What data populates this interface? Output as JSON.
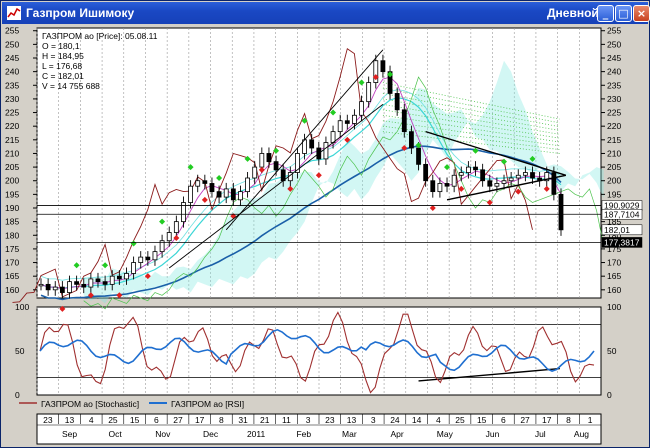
{
  "window": {
    "title": "Газпром Ишимоку",
    "mode": "Дневной"
  },
  "window_buttons": {
    "minimize": "_",
    "maximize": "□",
    "close": "×"
  },
  "price_panel": {
    "info": [
      "ГАЗПРОМ ао [Price]: 05.08.11",
      "O = 180,1",
      "H = 184,95",
      "L = 176,68",
      "C = 182,01",
      "V = 14 755 688"
    ],
    "yticks": [
      160,
      165,
      170,
      175,
      180,
      185,
      190,
      195,
      200,
      205,
      210,
      215,
      220,
      225,
      230,
      235,
      240,
      245,
      250,
      255
    ],
    "ylim": [
      157,
      256
    ],
    "price_labels": [
      {
        "text": "190,9029",
        "value": 190.9,
        "color": "#000000",
        "bg": "#ffffff"
      },
      {
        "text": "187,7104",
        "value": 187.7,
        "color": "#000000",
        "bg": "#ffffff"
      },
      {
        "text": "182,01",
        "value": 182.01,
        "color": "#000000",
        "bg": "#ffffff"
      },
      {
        "text": "177,3817",
        "value": 177.38,
        "color": "#ffffff",
        "bg": "#000000"
      }
    ]
  },
  "indicator_panel": {
    "yticks": [
      0,
      50,
      100
    ],
    "ylim": [
      0,
      100
    ],
    "levels": [
      20,
      80
    ]
  },
  "legend": [
    {
      "label": "ГАЗПРОМ ао [Stochastic]",
      "color": "#a03030"
    },
    {
      "label": "ГАЗПРОМ ао [RSI]",
      "color": "#1f6fd0"
    }
  ],
  "xaxis": {
    "days": [
      "23",
      "13",
      "4",
      "25",
      "15",
      "6",
      "27",
      "17",
      "8",
      "31",
      "21",
      "11",
      "3",
      "23",
      "13",
      "3",
      "24",
      "14",
      "4",
      "25",
      "15",
      "6",
      "27",
      "17",
      "8",
      "1"
    ],
    "months": [
      "Sep",
      "Oct",
      "Nov",
      "Dec",
      "2011",
      "Feb",
      "Mar",
      "Apr",
      "May",
      "Jun",
      "Jul",
      "Aug"
    ],
    "month_index": [
      1.5,
      3.6,
      5.8,
      8.0,
      10.1,
      12.3,
      14.4,
      16.6,
      18.8,
      21.0,
      23.2,
      25.1
    ]
  },
  "chart_data": [
    {
      "type": "line",
      "title": "ГАЗПРОМ ао [Price]: 05.08.11",
      "x_start": "2010-08-20",
      "x_end": "2011-08-05",
      "ylim": [
        157,
        256
      ],
      "series": [
        {
          "name": "ГАЗПРОМ ао [Price]",
          "color": "#000000",
          "values": [
            162,
            160,
            161,
            159,
            163,
            162,
            161,
            164,
            163,
            162,
            165,
            164,
            166,
            170,
            172,
            171,
            174,
            178,
            181,
            185,
            192,
            198,
            200,
            199,
            196,
            194,
            197,
            193,
            196,
            201,
            205,
            210,
            207,
            204,
            200,
            203,
            210,
            215,
            212,
            208,
            214,
            218,
            222,
            221,
            224,
            229,
            236,
            244,
            240,
            232,
            226,
            218,
            212,
            206,
            200,
            196,
            199,
            198,
            202,
            203,
            205,
            204,
            200,
            198,
            199,
            200,
            201,
            202,
            203,
            201,
            200,
            203,
            195,
            182
          ]
        }
      ],
      "annotations": [
        "Ishimoku cloud",
        "tenkan/kijun lines",
        "trend channel",
        "triangle",
        "buy/sell markers"
      ]
    },
    {
      "type": "line",
      "ylim": [
        0,
        100
      ],
      "series": [
        {
          "name": "ГАЗПРОМ ао [Stochastic]",
          "color": "#a03030"
        },
        {
          "name": "ГАЗПРОМ ао [RSI]",
          "color": "#1f6fd0"
        }
      ]
    }
  ]
}
